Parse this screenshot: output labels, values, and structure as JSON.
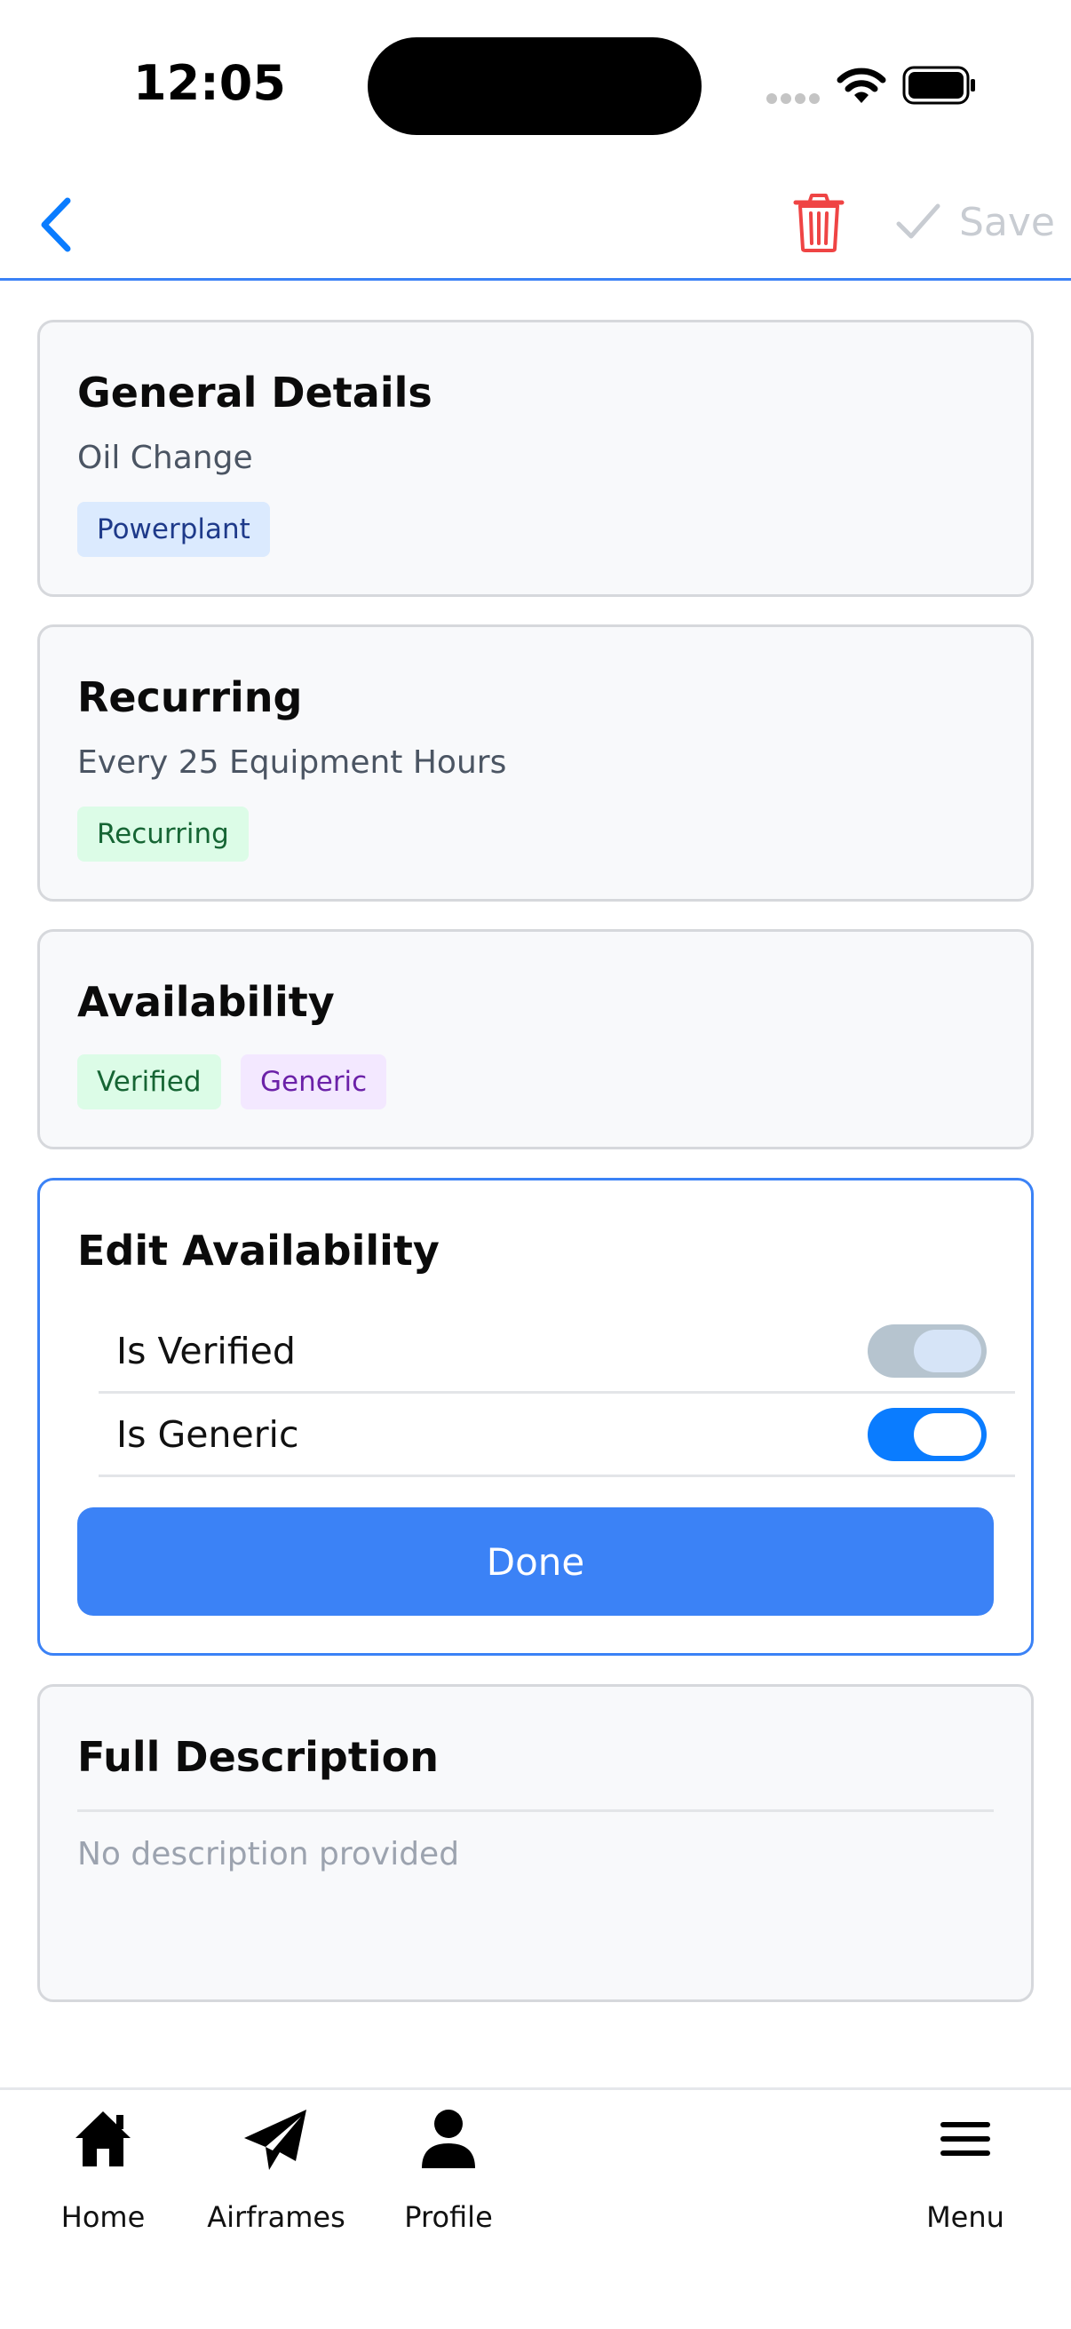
{
  "status_bar": {
    "time": "12:05"
  },
  "nav": {
    "save_label": "Save"
  },
  "general": {
    "title": "General Details",
    "name": "Oil Change",
    "tag": "Powerplant"
  },
  "recurring": {
    "title": "Recurring",
    "interval": "Every 25 Equipment Hours",
    "tag": "Recurring"
  },
  "availability": {
    "title": "Availability",
    "tags": [
      "Verified",
      "Generic"
    ]
  },
  "edit_availability": {
    "title": "Edit Availability",
    "toggles": [
      {
        "label": "Is Verified",
        "state": "on-disabled"
      },
      {
        "label": "Is Generic",
        "state": "on"
      }
    ],
    "done_label": "Done"
  },
  "description": {
    "title": "Full Description",
    "placeholder": "No description provided"
  },
  "tabs": [
    {
      "label": "Home",
      "icon": "home-icon"
    },
    {
      "label": "Airframes",
      "icon": "paper-plane-icon"
    },
    {
      "label": "Profile",
      "icon": "person-icon"
    },
    {
      "label": "Menu",
      "icon": "hamburger-icon"
    }
  ],
  "colors": {
    "accent": "#3b82f6",
    "toggle_on": "#0a7cff",
    "danger": "#ef4444"
  }
}
